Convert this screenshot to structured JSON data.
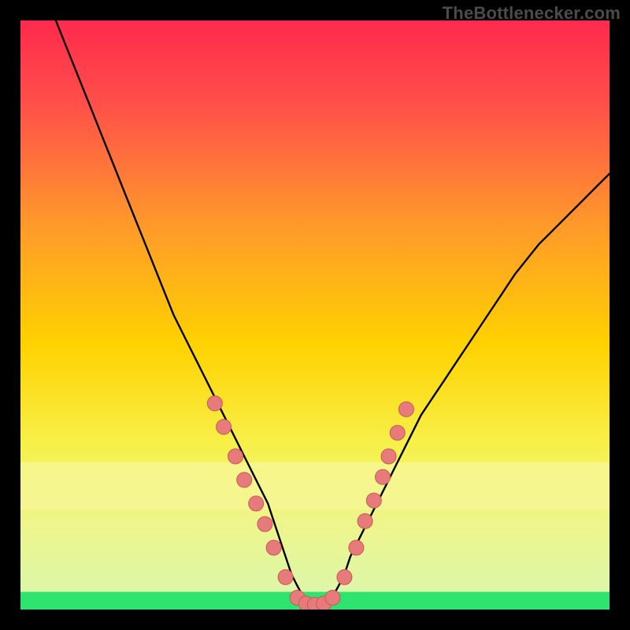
{
  "attribution": "TheBottlenecker.com",
  "colors": {
    "frame": "#000000",
    "curve": "#000000",
    "highlight_band_yellow": "#f7f79a",
    "highlight_band_green": "#2fe36f",
    "dot_fill": "#e77a7a",
    "dot_stroke": "#c95858",
    "gradient_top": "#ff2a4d",
    "gradient_mid": "#ffd200",
    "gradient_bottom": "#2fe36f",
    "attrib_text": "#4b4b4b"
  },
  "chart_data": {
    "type": "line",
    "title": "",
    "xlabel": "",
    "ylabel": "",
    "xlim": [
      0,
      100
    ],
    "ylim": [
      0,
      100
    ],
    "curve": {
      "x": [
        6,
        8,
        10,
        12,
        14,
        16,
        18,
        20,
        22,
        24,
        26,
        28,
        30,
        32,
        34,
        36,
        38,
        40,
        42,
        43,
        44,
        45,
        46,
        47,
        48,
        49,
        50,
        51,
        52,
        53,
        54,
        55,
        56,
        58,
        60,
        62,
        64,
        66,
        68,
        70,
        72,
        74,
        76,
        78,
        80,
        82,
        84,
        86,
        88,
        90,
        92,
        94,
        96,
        98,
        100
      ],
      "y": [
        100,
        95,
        90,
        85,
        80,
        75,
        70,
        65,
        60,
        55,
        50,
        46,
        42,
        38,
        34,
        30,
        26,
        22,
        18,
        15,
        12,
        9,
        6,
        4,
        2.2,
        1.2,
        0.8,
        0.8,
        1.2,
        2.2,
        4,
        6,
        9,
        13,
        17,
        21,
        25,
        29,
        33,
        36,
        39,
        42,
        45,
        48,
        51,
        54,
        57,
        59.5,
        62,
        64,
        66,
        68,
        70,
        72,
        74
      ]
    },
    "highlighted_points": [
      {
        "x": 33.0,
        "y": 35.0
      },
      {
        "x": 34.5,
        "y": 31.0
      },
      {
        "x": 36.5,
        "y": 26.0
      },
      {
        "x": 38.0,
        "y": 22.0
      },
      {
        "x": 40.0,
        "y": 18.0
      },
      {
        "x": 41.5,
        "y": 14.5
      },
      {
        "x": 43.0,
        "y": 10.5
      },
      {
        "x": 45.0,
        "y": 5.5
      },
      {
        "x": 47.0,
        "y": 2.0
      },
      {
        "x": 48.5,
        "y": 1.0
      },
      {
        "x": 50.0,
        "y": 0.8
      },
      {
        "x": 51.5,
        "y": 1.0
      },
      {
        "x": 53.0,
        "y": 2.0
      },
      {
        "x": 55.0,
        "y": 5.5
      },
      {
        "x": 57.0,
        "y": 10.5
      },
      {
        "x": 58.5,
        "y": 15.0
      },
      {
        "x": 60.0,
        "y": 18.5
      },
      {
        "x": 61.5,
        "y": 22.5
      },
      {
        "x": 62.5,
        "y": 26.0
      },
      {
        "x": 64.0,
        "y": 30.0
      },
      {
        "x": 65.5,
        "y": 34.0
      }
    ],
    "bands": [
      {
        "name": "pale-yellow",
        "y_top": 25,
        "y_bottom": 17,
        "color": "#f7f79a"
      },
      {
        "name": "green",
        "y_top": 3,
        "y_bottom": 0,
        "color": "#2fe36f"
      }
    ]
  }
}
